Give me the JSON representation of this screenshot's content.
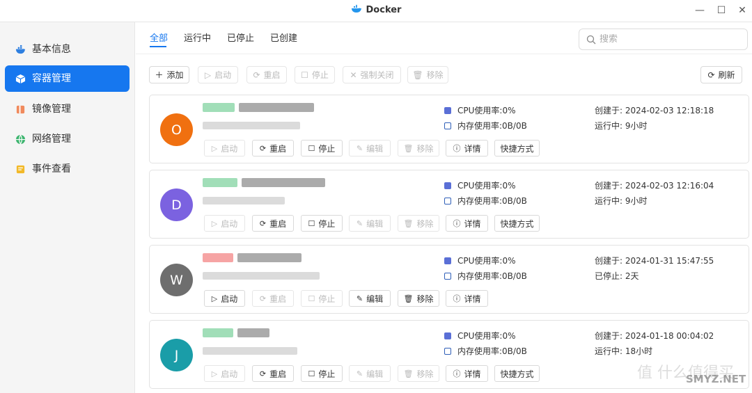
{
  "window": {
    "title": "Docker",
    "brand_color": "#1677ef"
  },
  "sidebar": {
    "items": [
      {
        "label": "基本信息",
        "icon": "docker-whale-icon",
        "active": false
      },
      {
        "label": "容器管理",
        "icon": "container-cube-icon",
        "active": true
      },
      {
        "label": "镜像管理",
        "icon": "image-layers-icon",
        "active": false
      },
      {
        "label": "网络管理",
        "icon": "globe-network-icon",
        "active": false
      },
      {
        "label": "事件查看",
        "icon": "event-log-icon",
        "active": false
      }
    ]
  },
  "tabs": [
    {
      "label": "全部",
      "active": true
    },
    {
      "label": "运行中",
      "active": false
    },
    {
      "label": "已停止",
      "active": false
    },
    {
      "label": "已创建",
      "active": false
    }
  ],
  "search": {
    "placeholder": "搜索",
    "value": ""
  },
  "toolbar": {
    "add": "添加",
    "start": "启动",
    "restart": "重启",
    "stop": "停止",
    "force_stop": "强制关闭",
    "remove": "移除",
    "refresh": "刷新"
  },
  "labels": {
    "cpu": "CPU使用率: ",
    "mem": "内存使用率: ",
    "created": "创建于: ",
    "start": "启动",
    "restart": "重启",
    "stop": "停止",
    "edit": "编辑",
    "remove": "移除",
    "details": "详情",
    "shortcut": "快捷方式"
  },
  "containers": [
    {
      "initial": "O",
      "avatar_color": "#f07010",
      "cpu": "0%",
      "mem": "0B/0B",
      "created": "2024-02-03 12:18:18",
      "status_label": "运行中: ",
      "status_value": "9小时",
      "state": "running"
    },
    {
      "initial": "D",
      "avatar_color": "#7b62e0",
      "cpu": "0%",
      "mem": "0B/0B",
      "created": "2024-02-03 12:16:04",
      "status_label": "运行中: ",
      "status_value": "9小时",
      "state": "running"
    },
    {
      "initial": "W",
      "avatar_color": "#6e6e6e",
      "cpu": "0%",
      "mem": "0B/0B",
      "created": "2024-01-31 15:47:55",
      "status_label": "已停止: ",
      "status_value": "2天",
      "state": "stopped"
    },
    {
      "initial": "J",
      "avatar_color": "#1a9da8",
      "cpu": "0%",
      "mem": "0B/0B",
      "created": "2024-01-18 00:04:02",
      "status_label": "运行中: ",
      "status_value": "18小时",
      "state": "running"
    }
  ],
  "watermark": {
    "line1": "值 什么值得买",
    "line2": "SMYZ.NET"
  }
}
